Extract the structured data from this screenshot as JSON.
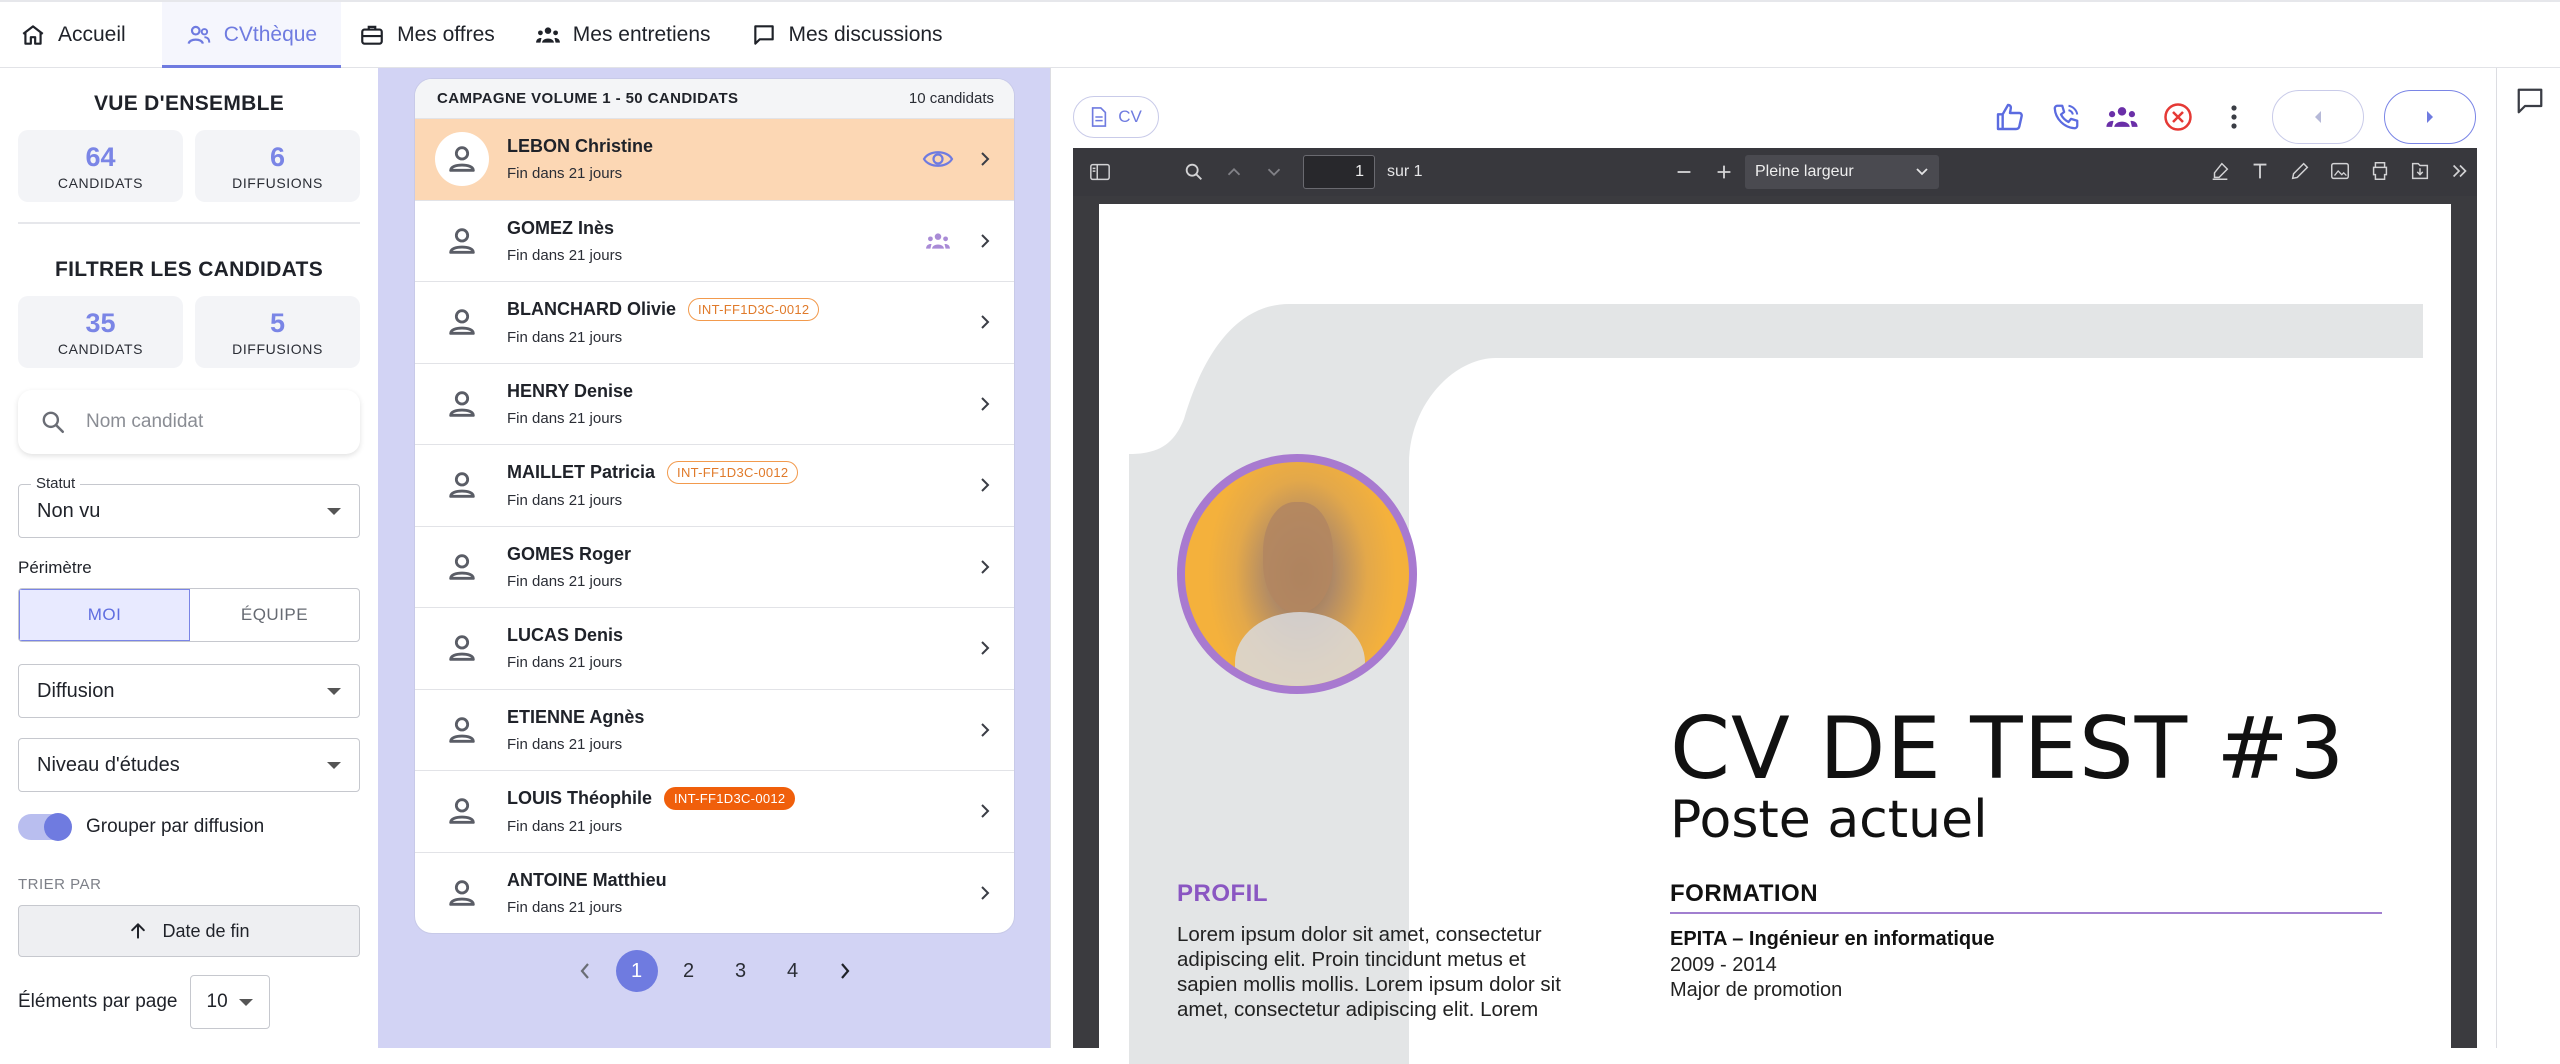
{
  "nav": {
    "items": [
      {
        "label": "Accueil",
        "icon": "home-icon"
      },
      {
        "label": "CVthèque",
        "icon": "users-icon"
      },
      {
        "label": "Mes offres",
        "icon": "briefcase-icon"
      },
      {
        "label": "Mes entretiens",
        "icon": "group-icon"
      },
      {
        "label": "Mes discussions",
        "icon": "chat-icon"
      }
    ],
    "active_index": 1
  },
  "overview": {
    "title": "VUE D'ENSEMBLE",
    "candidats_value": "64",
    "candidats_label": "CANDIDATS",
    "diffusions_value": "6",
    "diffusions_label": "DIFFUSIONS"
  },
  "filters": {
    "title": "FILTRER LES CANDIDATS",
    "candidats_value": "35",
    "candidats_label": "CANDIDATS",
    "diffusions_value": "5",
    "diffusions_label": "DIFFUSIONS",
    "search_placeholder": "Nom candidat",
    "statut_label": "Statut",
    "statut_value": "Non vu",
    "perimetre_label": "Périmètre",
    "perimetre_options": [
      "MOI",
      "ÉQUIPE"
    ],
    "perimetre_selected": "MOI",
    "diffusion_value": "Diffusion",
    "niveau_value": "Niveau d'études",
    "group_label": "Grouper par diffusion",
    "group_enabled": true,
    "sort_label": "TRIER PAR",
    "sort_value": "Date de fin",
    "per_page_label": "Éléments par page",
    "per_page_value": "10"
  },
  "list": {
    "title": "CAMPAGNE VOLUME 1 - 50 CANDIDATS",
    "count": "10 candidats",
    "candidates": [
      {
        "name": "LEBON Christine",
        "sub": "Fin dans 21 jours",
        "badge": "",
        "badge_style": "",
        "status_icon": "eye-icon",
        "selected": true
      },
      {
        "name": "GOMEZ Inès",
        "sub": "Fin dans 21 jours",
        "badge": "",
        "badge_style": "",
        "status_icon": "group-icon",
        "selected": false
      },
      {
        "name": "BLANCHARD Olivie",
        "sub": "Fin dans 21 jours",
        "badge": "INT-FF1D3C-0012",
        "badge_style": "outline",
        "status_icon": "",
        "selected": false
      },
      {
        "name": "HENRY Denise",
        "sub": "Fin dans 21 jours",
        "badge": "",
        "badge_style": "",
        "status_icon": "",
        "selected": false
      },
      {
        "name": "MAILLET Patricia",
        "sub": "Fin dans 21 jours",
        "badge": "INT-FF1D3C-0012",
        "badge_style": "outline",
        "status_icon": "",
        "selected": false
      },
      {
        "name": "GOMES Roger",
        "sub": "Fin dans 21 jours",
        "badge": "",
        "badge_style": "",
        "status_icon": "",
        "selected": false
      },
      {
        "name": "LUCAS Denis",
        "sub": "Fin dans 21 jours",
        "badge": "",
        "badge_style": "",
        "status_icon": "",
        "selected": false
      },
      {
        "name": "ETIENNE Agnès",
        "sub": "Fin dans 21 jours",
        "badge": "",
        "badge_style": "",
        "status_icon": "",
        "selected": false
      },
      {
        "name": "LOUIS Théophile",
        "sub": "Fin dans 21 jours",
        "badge": "INT-FF1D3C-0012",
        "badge_style": "filled",
        "status_icon": "",
        "selected": false
      },
      {
        "name": "ANTOINE Matthieu",
        "sub": "Fin dans 21 jours",
        "badge": "",
        "badge_style": "",
        "status_icon": "",
        "selected": false
      }
    ],
    "pages": [
      "1",
      "2",
      "3",
      "4"
    ],
    "current_page": "1"
  },
  "viewer": {
    "chip_label": "CV",
    "actions": [
      "thumbs-up-icon",
      "phone-icon",
      "group-icon",
      "reject-icon",
      "more-vert-icon"
    ],
    "pdf": {
      "page_value": "1",
      "page_total": "sur 1",
      "zoom": "Pleine largeur"
    },
    "cv": {
      "title": "CV DE TEST #3",
      "subtitle": "Poste actuel",
      "profil_heading": "PROFIL",
      "profil_text": "Lorem ipsum dolor sit amet, consectetur adipiscing elit. Proin tincidunt metus et sapien mollis mollis. Lorem ipsum dolor sit amet, consectetur adipiscing elit. Lorem",
      "formation_heading": "FORMATION",
      "school": "EPITA – Ingénieur en informatique",
      "years": "2009 - 2014",
      "mention": "Major de promotion"
    }
  },
  "colors": {
    "accent": "#6f7be0",
    "list_bg": "#d2d3f4",
    "selected_row": "#fcd7b4",
    "badge_orange": "#f05f0b",
    "cv_purple": "#8a56c2",
    "photo_bg": "#f4b13c"
  }
}
